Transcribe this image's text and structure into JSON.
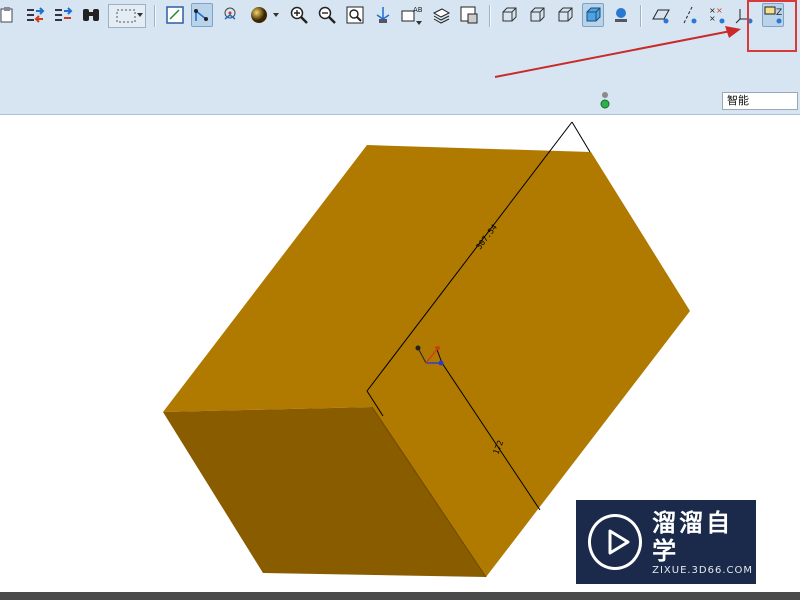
{
  "toolbar": {
    "icons": [
      {
        "name": "paste-icon"
      },
      {
        "name": "regenerate-icon"
      },
      {
        "name": "regenerate-manager-icon"
      },
      {
        "name": "find-binoculars-icon"
      },
      {
        "name": "select-box-icon"
      },
      {
        "name": "sketch-view-icon"
      },
      {
        "name": "datum-display-icon"
      },
      {
        "name": "spin-center-icon"
      },
      {
        "name": "appearance-sphere-icon"
      },
      {
        "name": "zoom-in-icon"
      },
      {
        "name": "zoom-out-icon"
      },
      {
        "name": "refit-icon"
      },
      {
        "name": "reorient-icon"
      },
      {
        "name": "saved-views-icon"
      },
      {
        "name": "layers-icon"
      },
      {
        "name": "view-manager-icon"
      },
      {
        "name": "wireframe-icon"
      },
      {
        "name": "hidden-line-icon"
      },
      {
        "name": "no-hidden-icon"
      },
      {
        "name": "shading-icon"
      },
      {
        "name": "model-tree-icon"
      },
      {
        "name": "datum-planes-icon"
      },
      {
        "name": "datum-axes-icon"
      },
      {
        "name": "datum-points-icon"
      },
      {
        "name": "coordinate-systems-icon"
      },
      {
        "name": "annotation-display-icon"
      }
    ],
    "highlight_label": "Z",
    "filter_value": "智能",
    "accent_color": "#d63a3a"
  },
  "model": {
    "dimension_length": "307.54",
    "dimension_depth": "172",
    "top_face_color": "#b07a00",
    "front_face_color": "#8a5c00"
  },
  "watermark": {
    "title": "溜溜自学",
    "subtitle": "ZIXUE.3D66.COM"
  }
}
